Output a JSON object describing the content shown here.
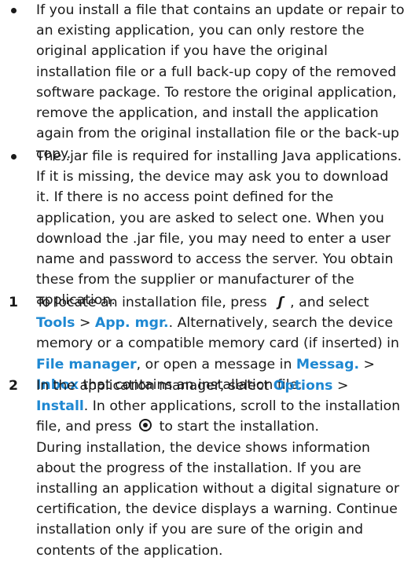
{
  "bullets": [
    {
      "text": "If you install a file that contains an update or repair to an existing application, you can only restore the original application if you have the original installation file or a full back-up copy of the removed software package. To restore the original application, remove the application, and install the application again from the original installation file or the back-up copy."
    },
    {
      "text": "The .jar file is required for installing Java applications. If it is missing, the device may ask you to download it. If there is no access point defined for the application, you are asked to select one. When you download the .jar file, you may need to enter a user name and password to access the server. You obtain these from the supplier or manufacturer of the application."
    }
  ],
  "steps": [
    {
      "number": "1",
      "t1": "To locate an installation file, press",
      "t2": ", and select",
      "link_tools": "Tools",
      "sep1": " > ",
      "link_appmgr": "App. mgr.",
      "t3": ". Alternatively, search the device memory or a compatible memory card (if inserted) in",
      "link_filemanager": "File manager",
      "t4": ", or open a message in",
      "link_messag": "Messag.",
      "sep2": " > ",
      "link_inbox": "Inbox",
      "t5": "that contains an installation file."
    },
    {
      "number": "2",
      "t1": "In the application manager, select",
      "link_options": "Options",
      "sep1": " > ",
      "link_install": "Install",
      "t2": ". In other applications, scroll to the installation file, and press",
      "t3": "to start the installation.",
      "para2": "During installation, the device shows information about the progress of the installation. If you are installing an application without a digital signature or certification, the device displays a warning. Continue installation only if you are sure of the origin and contents of the application."
    }
  ],
  "icons": {
    "menu_key": "menu-key-icon",
    "select_key": "select-key-icon",
    "menu_key_glyph": "ʃ̣"
  },
  "colors": {
    "link": "#1e88d2",
    "text": "#1a1a1a"
  }
}
